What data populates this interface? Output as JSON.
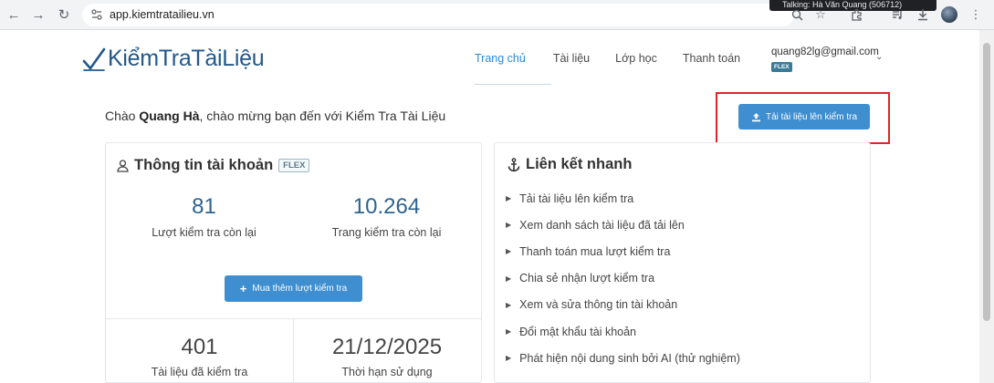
{
  "browser": {
    "url": "app.kiemtratailieu.vn",
    "tooltip": "Talking: Hà Văn Quang (506712)"
  },
  "header": {
    "logo_text": "KiểmTraTàiLiệu",
    "nav": [
      {
        "label": "Trang chủ",
        "active": true
      },
      {
        "label": "Tài liệu",
        "active": false
      },
      {
        "label": "Lớp học",
        "active": false
      },
      {
        "label": "Thanh toán",
        "active": false
      }
    ],
    "user_email": "quang82lg@gmail.com",
    "user_badge": "FLEX"
  },
  "greeting": {
    "prefix": "Chào ",
    "name": "Quang Hà",
    "suffix": ", chào mừng bạn đến với Kiểm Tra Tài Liệu"
  },
  "upload_button": "Tải tài liệu lên kiểm tra",
  "account": {
    "title": "Thông tin tài khoản",
    "plan": "FLEX",
    "stats": [
      {
        "value": "81",
        "label": "Lượt kiểm tra còn lại"
      },
      {
        "value": "10.264",
        "label": "Trang kiểm tra còn lại"
      }
    ],
    "buy_button": "Mua thêm lượt kiểm tra",
    "bottom_stats": [
      {
        "value": "401",
        "label": "Tài liệu đã kiểm tra"
      },
      {
        "value": "21/12/2025",
        "label": "Thời hạn sử dụng"
      }
    ]
  },
  "quick_links": {
    "title": "Liên kết nhanh",
    "items": [
      "Tải tài liệu lên kiểm tra",
      "Xem danh sách tài liệu đã tải lên",
      "Thanh toán mua lượt kiểm tra",
      "Chia sẻ nhận lượt kiểm tra",
      "Xem và sửa thông tin tài khoản",
      "Đổi mật khẩu tài khoản",
      "Phát hiện nội dung sinh bởi AI (thử nghiệm)"
    ]
  },
  "colors": {
    "accent": "#3e8ed0",
    "brand": "#22588a",
    "highlight": "#e0242c"
  }
}
